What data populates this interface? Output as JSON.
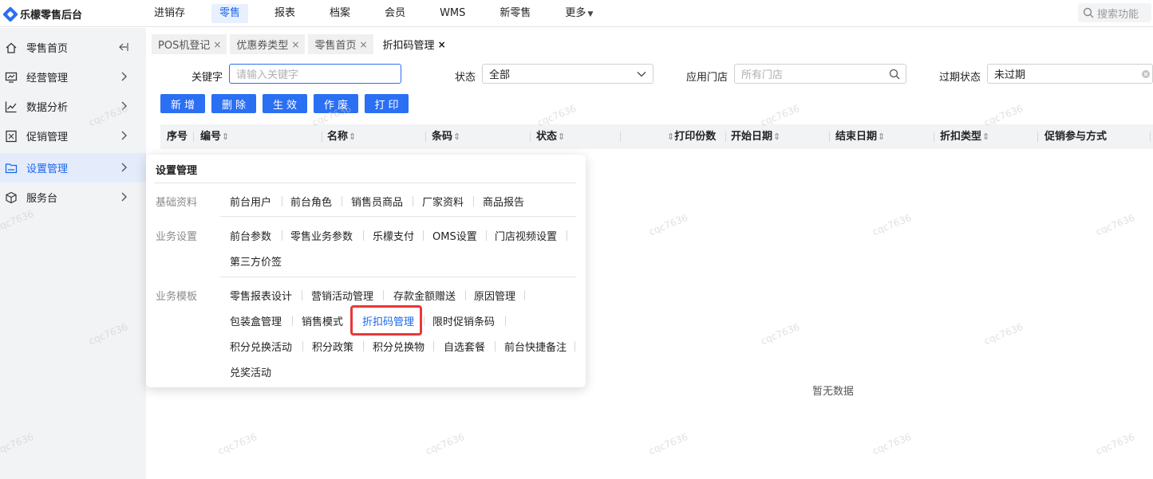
{
  "app": {
    "name": "乐檬零售后台"
  },
  "topnav": {
    "items": [
      "进销存",
      "零售",
      "报表",
      "档案",
      "会员",
      "WMS",
      "新零售",
      "更多"
    ],
    "search_placeholder": "搜索功能"
  },
  "sidebar": {
    "items": [
      {
        "label": "零售首页",
        "icon": "home-icon"
      },
      {
        "label": "经营管理",
        "icon": "monitor-icon"
      },
      {
        "label": "数据分析",
        "icon": "chart-icon"
      },
      {
        "label": "促销管理",
        "icon": "promo-icon"
      },
      {
        "label": "设置管理",
        "icon": "folder-icon"
      },
      {
        "label": "服务台",
        "icon": "cube-icon"
      }
    ]
  },
  "tabs": [
    {
      "label": "POS机登记"
    },
    {
      "label": "优惠券类型"
    },
    {
      "label": "零售首页"
    },
    {
      "label": "折扣码管理"
    }
  ],
  "filters": {
    "keyword_label": "关键字",
    "keyword_placeholder": "请输入关键字",
    "status_label": "状态",
    "status_value": "全部",
    "store_label": "应用门店",
    "store_placeholder": "所有门店",
    "expire_label": "过期状态",
    "expire_value": "未过期"
  },
  "actions": [
    "新增",
    "删除",
    "生效",
    "作废",
    "打印"
  ],
  "table": {
    "columns": [
      "序号",
      "编号",
      "名称",
      "条码",
      "状态",
      "打印份数",
      "开始日期",
      "结束日期",
      "折扣类型",
      "促销参与方式"
    ],
    "empty_text": "暂无数据"
  },
  "watermark": "cqc7636",
  "menu": {
    "title": "设置管理",
    "sections": [
      {
        "label": "基础资料",
        "rows": [
          [
            "前台用户",
            "前台角色",
            "销售员商品",
            "厂家资料",
            "商品报告"
          ]
        ]
      },
      {
        "label": "业务设置",
        "rows": [
          [
            "前台参数",
            "零售业务参数",
            "乐檬支付",
            "OMS设置",
            "门店视频设置"
          ],
          [
            "第三方价签"
          ]
        ]
      },
      {
        "label": "业务模板",
        "rows": [
          [
            "零售报表设计",
            "营销活动管理",
            "存款金额赠送",
            "原因管理"
          ],
          [
            "包装盒管理",
            "销售模式",
            "折扣码管理",
            "限时促销条码"
          ],
          [
            "积分兑换活动",
            "积分政策",
            "积分兑换物",
            "自选套餐",
            "前台快捷备注"
          ],
          [
            "兑奖活动"
          ]
        ]
      }
    ]
  },
  "colors": {
    "accent": "#2b6ff3",
    "highlight": "#e8383a"
  }
}
